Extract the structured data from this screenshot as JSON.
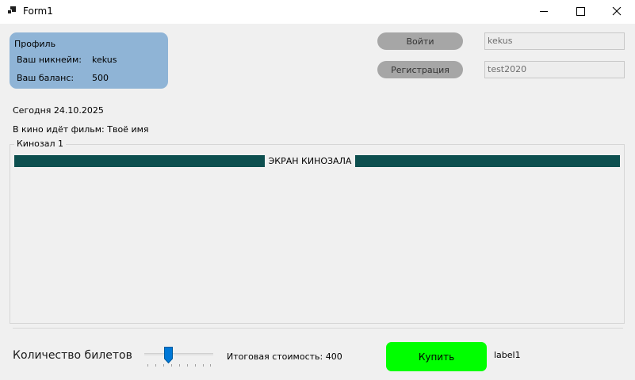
{
  "window": {
    "title": "Form1",
    "icon": "app-form-icon",
    "controls": [
      "minimize-icon",
      "maximize-icon",
      "close-icon"
    ]
  },
  "profile": {
    "heading": "Профиль",
    "nickname_label": "Ваш никнейм:",
    "nickname_value": "kekus",
    "balance_label": "Ваш баланс:",
    "balance_value": "500",
    "background_color": "#8fb4d6"
  },
  "auth": {
    "login_button": "Войти",
    "register_button": "Регистрация",
    "login_field_value": "kekus",
    "password_field_value": "test2020"
  },
  "info": {
    "date_text": "Сегодня 24.10.2025",
    "movie_text": "В кино идёт фильм: Твоё имя"
  },
  "hall": {
    "group_title": "Кинозал 1",
    "screen_label": "ЭКРАН КИНОЗАЛА",
    "screen_color": "#0d4f4f"
  },
  "footer": {
    "tickets_label": "Количество билетов",
    "tickets_slider_value": 3,
    "total_cost_text": "Итоговая стоимость: 400",
    "buy_button": "Купить",
    "buy_button_color": "#00ff00",
    "status_label": "label1"
  }
}
